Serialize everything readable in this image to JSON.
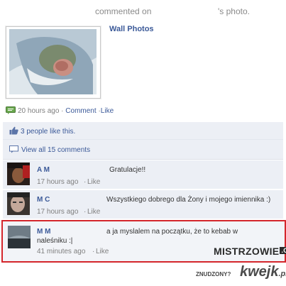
{
  "header": {
    "commented_on": "commented on",
    "photo_suffix": "'s photo."
  },
  "album": {
    "title": "Wall Photos"
  },
  "post_meta": {
    "time": "20 hours ago",
    "comment": "Comment",
    "like": "Like",
    "separator": "·"
  },
  "likes": {
    "text": "3 people like this."
  },
  "view_all": {
    "text": "View all 15 comments"
  },
  "comments": [
    {
      "name": "A        M",
      "text": "Gratulacje!!",
      "time": "17 hours ago",
      "like": "Like"
    },
    {
      "name": "M        C",
      "text": "Wszystkiego dobrego dla Żony i mojego imiennika :)",
      "time": "17 hours ago",
      "like": "Like"
    },
    {
      "name": "M        M",
      "text_line1": "a ja myslalem na początku, że to kebab w",
      "text_line2": "naleśniku :|",
      "time": "41 minutes ago",
      "like": "Like"
    }
  ],
  "watermarks": {
    "mistrzowie": "MISTRZOWIE",
    "org": ".ORG",
    "znudzony": "ZNUDZONY?",
    "kwejk": "kwejk",
    "pl": ".pl"
  },
  "colors": {
    "link": "#3b5998",
    "highlight_border": "#d4262c",
    "panel_bg": "#eceff5"
  }
}
